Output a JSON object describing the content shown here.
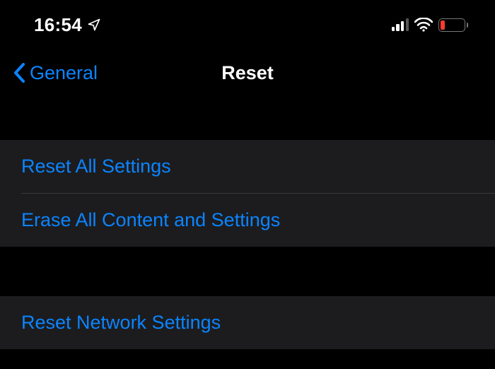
{
  "status": {
    "time": "16:54",
    "colors": {
      "accent": "#0b84ff",
      "battery_fill": "#ff3b30"
    }
  },
  "nav": {
    "back_label": "General",
    "title": "Reset"
  },
  "groups": [
    {
      "items": [
        {
          "label": "Reset All Settings"
        },
        {
          "label": "Erase All Content and Settings"
        }
      ]
    },
    {
      "items": [
        {
          "label": "Reset Network Settings"
        }
      ]
    }
  ]
}
